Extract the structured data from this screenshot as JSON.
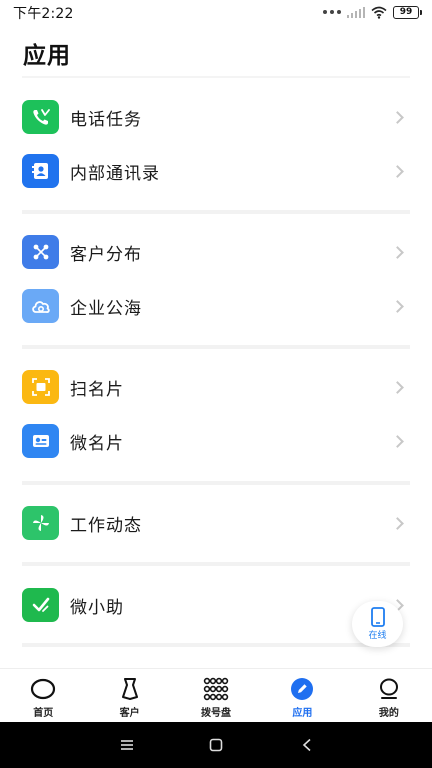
{
  "status_bar": {
    "time": "下午2:22",
    "battery": "99"
  },
  "header": {
    "title": "应用"
  },
  "groups": [
    {
      "items": [
        {
          "label": "电话任务",
          "icon": "phone-task-icon",
          "color": "#1dc15a"
        },
        {
          "label": "内部通讯录",
          "icon": "contacts-book-icon",
          "color": "#2073ee"
        }
      ]
    },
    {
      "items": [
        {
          "label": "客户分布",
          "icon": "network-nodes-icon",
          "color": "#3f7ce8"
        },
        {
          "label": "企业公海",
          "icon": "cloud-icon",
          "color": "#6aa9f6"
        }
      ]
    },
    {
      "items": [
        {
          "label": "扫名片",
          "icon": "scan-icon",
          "color": "#fbb812"
        },
        {
          "label": "微名片",
          "icon": "id-card-icon",
          "color": "#2f86f2"
        }
      ]
    },
    {
      "items": [
        {
          "label": "工作动态",
          "icon": "pinwheel-icon",
          "color": "#2dc46a"
        }
      ]
    },
    {
      "items": [
        {
          "label": "微小助",
          "icon": "check-assistant-icon",
          "color": "#1fb94e"
        }
      ]
    }
  ],
  "fab": {
    "label": "在线",
    "icon": "mobile-phone-icon"
  },
  "bottom_nav": {
    "items": [
      {
        "label": "首页",
        "icon": "home-circle-icon",
        "active": false
      },
      {
        "label": "客户",
        "icon": "customer-icon",
        "active": false
      },
      {
        "label": "拨号盘",
        "icon": "dialpad-icon",
        "active": false
      },
      {
        "label": "应用",
        "icon": "apps-pen-icon",
        "active": true
      },
      {
        "label": "我的",
        "icon": "profile-icon",
        "active": false
      }
    ],
    "active_color": "#1f6ff0"
  }
}
